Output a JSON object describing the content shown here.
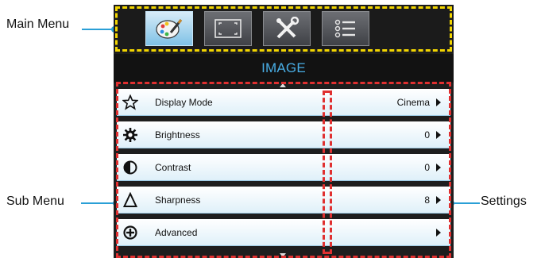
{
  "callouts": {
    "main_menu": "Main Menu",
    "sub_menu": "Sub Menu",
    "settings": "Settings"
  },
  "tabs": [
    {
      "icon": "palette-icon",
      "active": true
    },
    {
      "icon": "screen-corners-icon",
      "active": false
    },
    {
      "icon": "tools-icon",
      "active": false
    },
    {
      "icon": "list-icon",
      "active": false
    }
  ],
  "menu": {
    "title": "IMAGE",
    "items": [
      {
        "icon": "star-outline-icon",
        "label": "Display Mode",
        "value": "Cinema"
      },
      {
        "icon": "brightness-gear-icon",
        "label": "Brightness",
        "value": "0"
      },
      {
        "icon": "contrast-icon",
        "label": "Contrast",
        "value": "0"
      },
      {
        "icon": "delta-icon",
        "label": "Sharpness",
        "value": "8"
      },
      {
        "icon": "plus-circle-icon",
        "label": "Advanced",
        "value": ""
      }
    ]
  },
  "colors": {
    "accent_blue": "#49aee6",
    "callout_line": "#2a9fd6",
    "main_menu_outline": "#f2d500",
    "sub_menu_outline": "#e03030"
  }
}
